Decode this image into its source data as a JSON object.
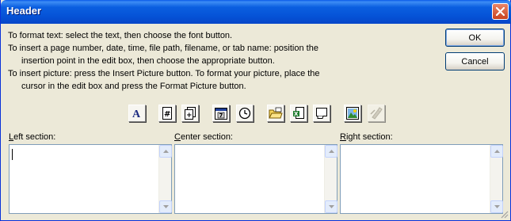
{
  "window": {
    "title": "Header"
  },
  "instructions": {
    "line1": "To format text:  select the text, then choose the font button.",
    "line2": "To insert a page number, date, time, file path, filename, or tab name:  position the",
    "line3": "insertion point in the edit box, then choose the appropriate button.",
    "line4": "To insert picture: press the Insert Picture button.  To format your picture, place the",
    "line5": "cursor in the edit box and press the Format Picture button."
  },
  "buttons": {
    "ok": "OK",
    "cancel": "Cancel"
  },
  "toolbar": {
    "items": [
      {
        "icon": "format-text-icon",
        "glyph": "A"
      },
      {
        "icon": "insert-page-number-icon",
        "glyph": "#"
      },
      {
        "icon": "insert-number-of-pages-icon",
        "glyph": "+"
      },
      {
        "icon": "insert-date-icon",
        "glyph": "7"
      },
      {
        "icon": "insert-time-icon"
      },
      {
        "icon": "insert-file-path-icon"
      },
      {
        "icon": "insert-file-name-icon"
      },
      {
        "icon": "insert-sheet-name-icon"
      },
      {
        "icon": "insert-picture-icon"
      },
      {
        "icon": "format-picture-icon",
        "disabled": true
      }
    ]
  },
  "sections": {
    "left": {
      "prefix": "",
      "mnemonic": "L",
      "rest": "eft section:"
    },
    "center": {
      "prefix": "",
      "mnemonic": "C",
      "rest": "enter section:"
    },
    "right": {
      "prefix": "",
      "mnemonic": "R",
      "rest": "ight section:"
    }
  }
}
